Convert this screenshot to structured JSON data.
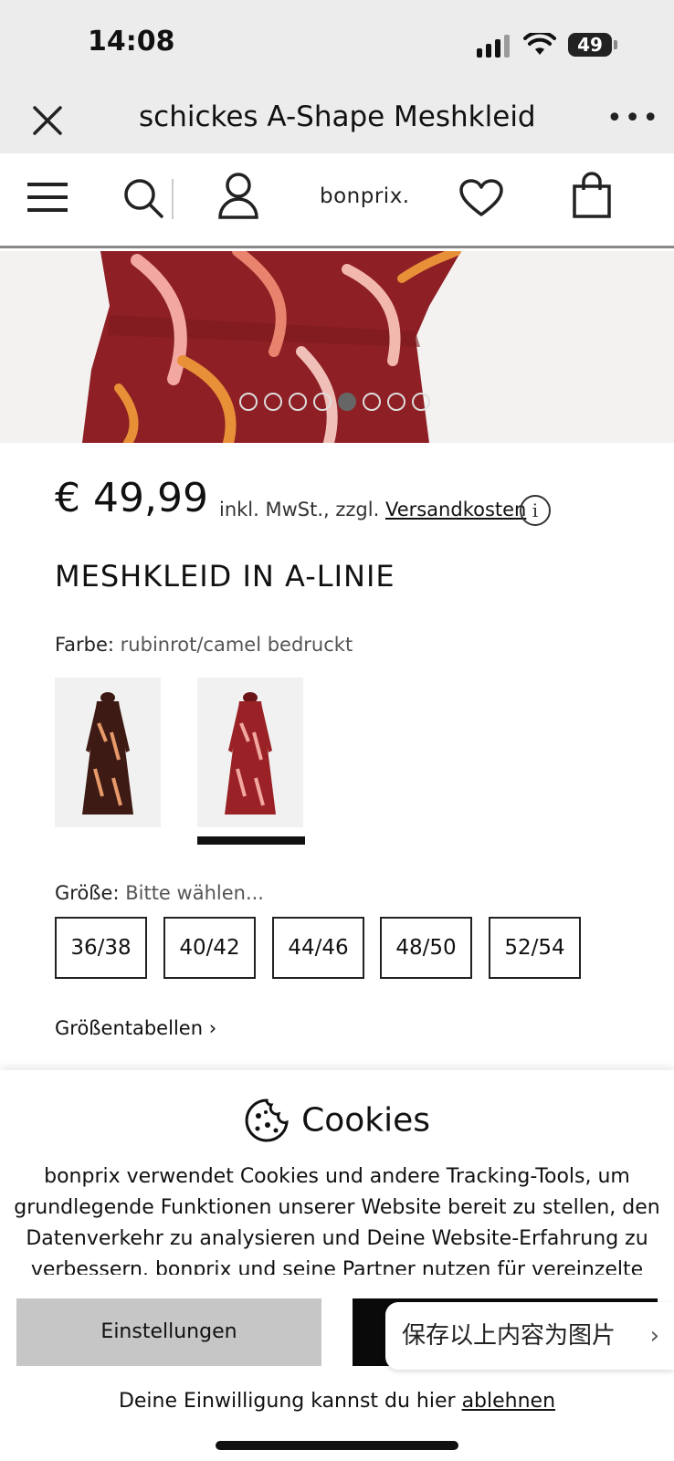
{
  "status_bar": {
    "time": "14:08",
    "battery": "49"
  },
  "browser": {
    "title": "schickes A-Shape Meshkleid"
  },
  "header": {
    "logo": "bonprix."
  },
  "gallery": {
    "dot_count": 8,
    "active_index": 4
  },
  "product": {
    "price": "€ 49,99",
    "price_note_prefix": "inkl. MwSt., zzgl.",
    "shipping_link": "Versandkosten",
    "title": "MESHKLEID IN A-LINIE",
    "color_label": "Farbe:",
    "color_value": "rubinrot/camel bedruckt",
    "size_label": "Größe:",
    "size_placeholder": "Bitte wählen...",
    "sizes": [
      "36/38",
      "40/42",
      "44/46",
      "48/50",
      "52/54"
    ],
    "size_tables_link": "Größentabellen"
  },
  "cookie_banner": {
    "title": "Cookies",
    "text": "bonprix verwendet Cookies und andere Tracking-Tools, um grundlegende Funktionen unserer Website bereit zu stellen, den Datenverkehr zu analysieren und Deine Website-Erfahrung zu verbessern. bonprix und seine Partner nutzen für vereinzelte",
    "settings_button": "Einstellungen",
    "consent_prefix": "Deine Einwilligung kannst du hier",
    "decline_link": "ablehnen"
  },
  "overlay_popup": {
    "label": "保存以上内容为图片"
  },
  "colors": {
    "accent": "#0a0a0a",
    "dress_red": "#8e1f24",
    "page_bg": "#ffffff"
  }
}
